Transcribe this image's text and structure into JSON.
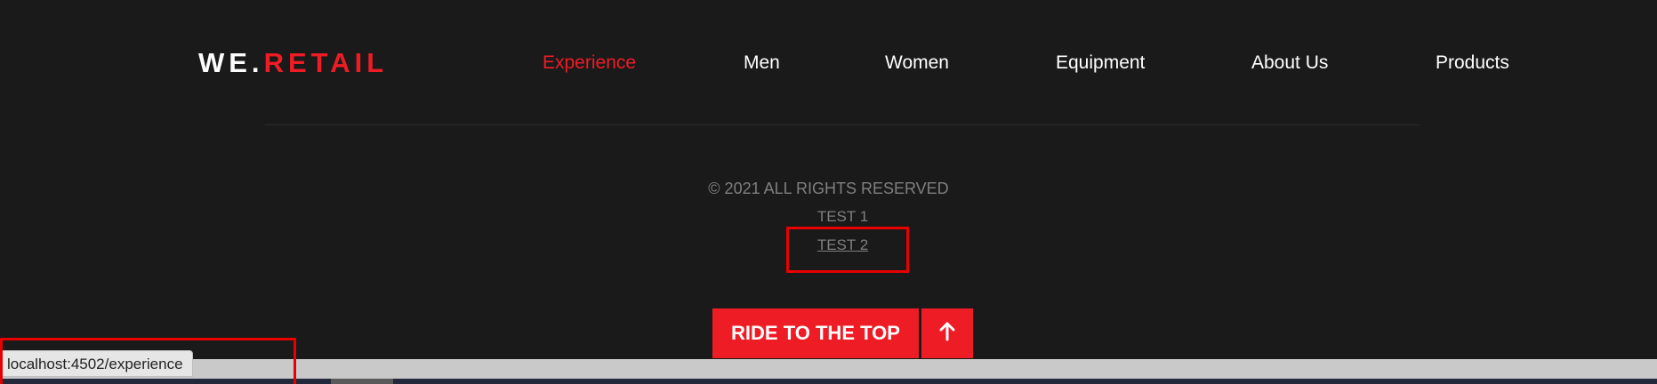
{
  "header": {
    "logo": {
      "part1": "WE.",
      "part2": "RETAIL"
    },
    "nav": [
      {
        "label": "Experience",
        "active": true
      },
      {
        "label": "Men"
      },
      {
        "label": "Women"
      },
      {
        "label": "Equipment"
      },
      {
        "label": "About Us"
      },
      {
        "label": "Products"
      }
    ]
  },
  "footer": {
    "copyright": "© 2021 ALL RIGHTS RESERVED",
    "links": [
      "TEST 1",
      "TEST 2"
    ],
    "back_to_top": {
      "label": "RIDE TO THE TOP",
      "icon": "arrow-up-icon"
    }
  },
  "browser": {
    "status_url": "localhost:4502/experience"
  },
  "colors": {
    "accent": "#ee1c25",
    "background": "#1a1a1a",
    "muted_text": "#7f7f7f",
    "highlight": "#e60000"
  }
}
